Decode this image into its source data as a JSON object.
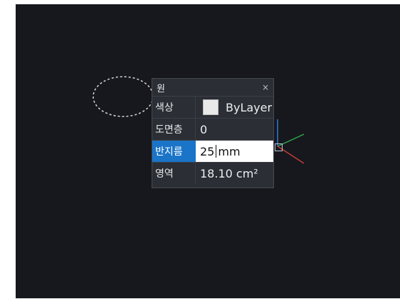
{
  "panel": {
    "title": "원",
    "close_glyph": "×",
    "rows": [
      {
        "label": "색상",
        "value": "ByLayer",
        "swatch_color": "#e9e9e9"
      },
      {
        "label": "도면층",
        "value": "0"
      },
      {
        "label": "반지름",
        "value_before_caret": "25",
        "value_after_caret": "mm"
      },
      {
        "label": "영역",
        "value": "18.10 cm²"
      }
    ]
  },
  "colors": {
    "canvas_bg": "#17181d",
    "panel_bg": "#2b2e34",
    "accent": "#1a74c8",
    "axis_green": "#2fa84f",
    "axis_red": "#c23b3b",
    "axis_blue": "#2f7bd8",
    "dashed_outline": "#d9d9d9"
  }
}
